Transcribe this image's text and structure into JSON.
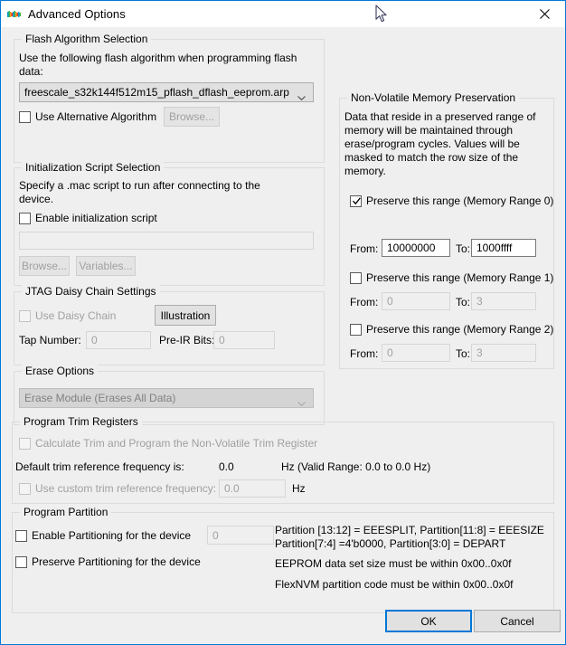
{
  "window": {
    "title": "Advanced Options",
    "icon": "nxp-logo-icon",
    "close_label": "✕"
  },
  "flash_algorithm": {
    "group_title": "Flash Algorithm Selection",
    "description": "Use the following flash algorithm when programming flash data:",
    "combo_value": "freescale_s32k144f512m15_pflash_dflash_eeprom.arp",
    "alt_checkbox_label": "Use Alternative Algorithm",
    "alt_checked": false,
    "browse_label": "Browse..."
  },
  "init_script": {
    "group_title": "Initialization Script Selection",
    "description": "Specify a .mac script to run after connecting to the device.",
    "enable_label": "Enable initialization script",
    "enable_checked": false,
    "path_value": "",
    "browse_label": "Browse...",
    "variables_label": "Variables..."
  },
  "jtag": {
    "group_title": "JTAG Daisy Chain Settings",
    "use_daisy_chain_label": "Use Daisy Chain",
    "use_daisy_chain_checked": false,
    "illustration_label": "Illustration",
    "tap_number_label": "Tap Number:",
    "tap_number_value": "0",
    "pre_ir_bits_label": "Pre-IR Bits:",
    "pre_ir_bits_value": "0"
  },
  "erase": {
    "group_title": "Erase Options",
    "combo_value": "Erase Module (Erases All Data)"
  },
  "nvm": {
    "group_title": "Non-Volatile Memory Preservation",
    "description": "Data that reside in a preserved range of memory will be maintained through erase/program cycles. Values will be masked to match the row size of the memory.",
    "ranges": [
      {
        "checkbox_label": "Preserve this range (Memory Range 0)",
        "checked": true,
        "from_label": "From:",
        "from_value": "10000000",
        "to_label": "To:",
        "to_value": "1000ffff"
      },
      {
        "checkbox_label": "Preserve this range (Memory Range 1)",
        "checked": false,
        "from_label": "From:",
        "from_value": "0",
        "to_label": "To:",
        "to_value": "3"
      },
      {
        "checkbox_label": "Preserve this range (Memory Range 2)",
        "checked": false,
        "from_label": "From:",
        "from_value": "0",
        "to_label": "To:",
        "to_value": "3"
      }
    ]
  },
  "trim": {
    "group_title": "Program Trim Registers",
    "calculate_label": "Calculate Trim and Program the Non-Volatile Trim Register",
    "calculate_checked": false,
    "default_freq_label": "Default trim reference frequency is:",
    "default_freq_value": "0.0",
    "default_freq_units": "Hz (Valid Range: 0.0 to 0.0 Hz)",
    "custom_freq_label": "Use custom trim reference frequency:",
    "custom_freq_checked": false,
    "custom_freq_value": "0.0",
    "custom_freq_units": "Hz"
  },
  "partition": {
    "group_title": "Program Partition",
    "enable_label": "Enable Partitioning for the device",
    "enable_checked": false,
    "partition_value": "0",
    "preserve_label": "Preserve Partitioning for the device",
    "preserve_checked": false,
    "info_line1": "Partition [13:12] = EEESPLIT, Partition[11:8] = EEESIZE",
    "info_line2": "Partition[7:4] =4'b0000, Partition[3:0] = DEPART",
    "info_line3": "EEPROM data set size must be within 0x00..0x0f",
    "info_line4": "FlexNVM partition code must be within 0x00..0x0f"
  },
  "footer": {
    "ok_label": "OK",
    "cancel_label": "Cancel"
  }
}
